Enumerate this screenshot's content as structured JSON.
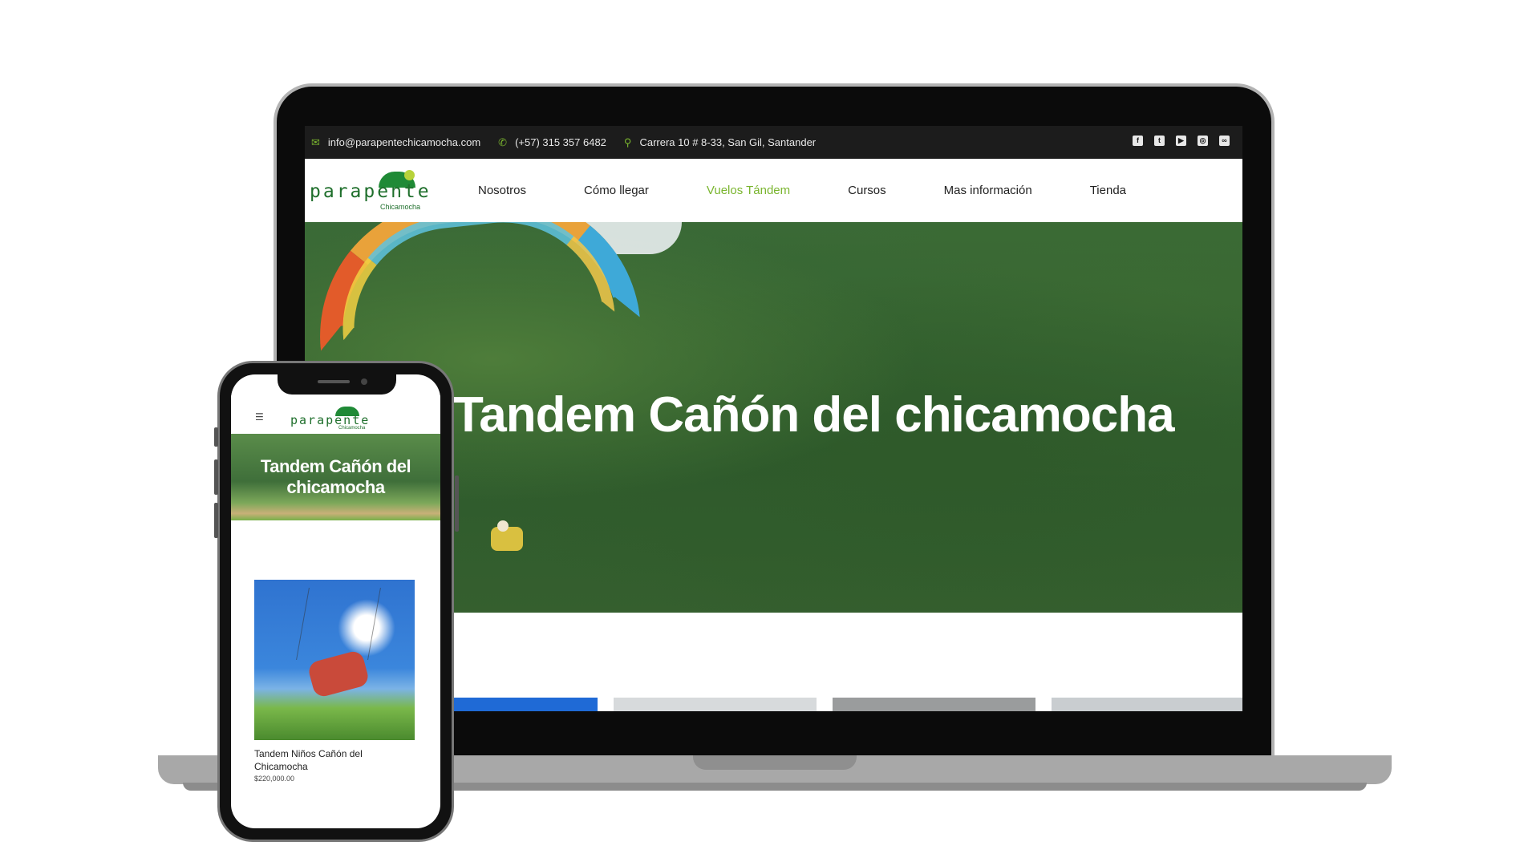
{
  "desktop": {
    "topbar": {
      "email": "info@parapentechicamocha.com",
      "phone": "(+57) 315 357 6482",
      "address": "Carrera 10 # 8-33, San Gil, Santander",
      "social_icons": [
        "facebook-icon",
        "twitter-icon",
        "youtube-icon",
        "instagram-icon",
        "tripadvisor-icon"
      ]
    },
    "logo": {
      "word": "parapente",
      "sub": "Chicamocha"
    },
    "nav": [
      {
        "label": "Nosotros"
      },
      {
        "label": "Cómo llegar"
      },
      {
        "label": "Vuelos Tándem"
      },
      {
        "label": "Cursos"
      },
      {
        "label": "Mas información"
      },
      {
        "label": "Tienda"
      }
    ],
    "active_nav": "Vuelos Tándem",
    "hero_title": "Tandem Cañón del chicamocha"
  },
  "mobile": {
    "logo": {
      "word": "parapente",
      "sub": "Chicamocha"
    },
    "hero_title": "Tandem Cañón del chicamocha",
    "product": {
      "title": "Tandem Niños Cañón del Chicamocha",
      "price": "$220,000.00"
    }
  },
  "colors": {
    "accent": "#7ab52f",
    "brand_green": "#1f6f2c",
    "topbar_bg": "#1c1c1c"
  }
}
